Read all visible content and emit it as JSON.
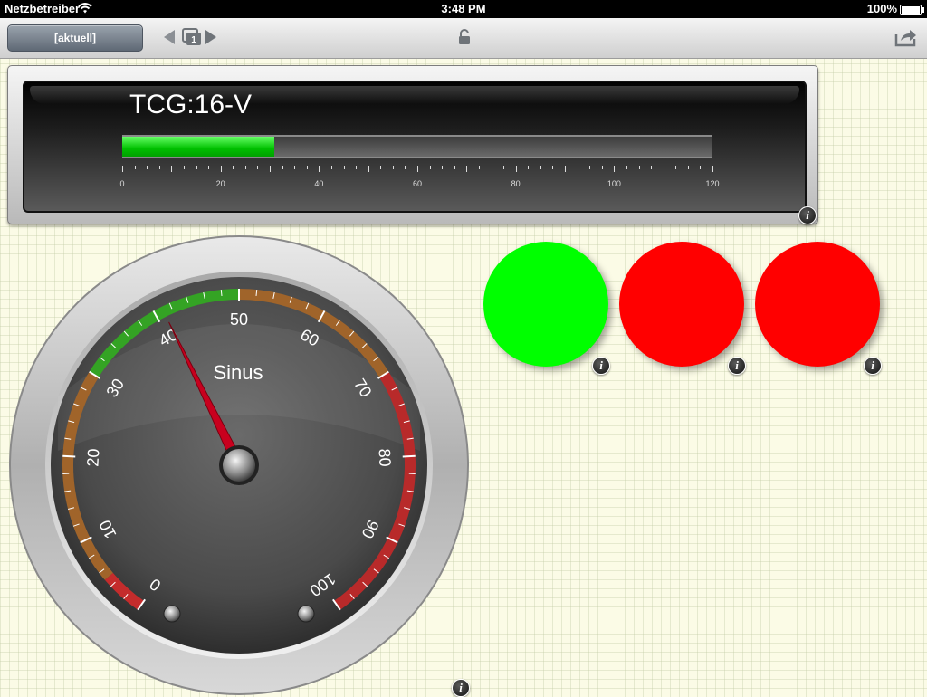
{
  "status_bar": {
    "carrier": "Netzbetreiber",
    "time": "3:48 PM",
    "battery": "100%"
  },
  "toolbar": {
    "current_button": "[aktuell]",
    "page_number": "1"
  },
  "bar_gauge": {
    "title": "TCG:16-V",
    "value": 31,
    "min": 0,
    "max": 120,
    "labels": [
      "0",
      "20",
      "40",
      "60",
      "80",
      "100",
      "120"
    ],
    "fill_color": "#00c000"
  },
  "lamps": [
    {
      "color": "#00ff00"
    },
    {
      "color": "#ff0000"
    },
    {
      "color": "#ff0000"
    }
  ],
  "dial": {
    "label": "Sinus",
    "value": 41,
    "min": 0,
    "max": 100,
    "labels": [
      "0",
      "10",
      "20",
      "30",
      "40",
      "50",
      "60",
      "70",
      "80",
      "90",
      "100"
    ],
    "zones": [
      {
        "from": 0,
        "to": 5,
        "color": "#c42c2c"
      },
      {
        "from": 5,
        "to": 30,
        "color": "#a0642a"
      },
      {
        "from": 30,
        "to": 50,
        "color": "#34a324"
      },
      {
        "from": 50,
        "to": 70,
        "color": "#a0642a"
      },
      {
        "from": 70,
        "to": 100,
        "color": "#b82a2a"
      }
    ]
  },
  "info_label": "i"
}
